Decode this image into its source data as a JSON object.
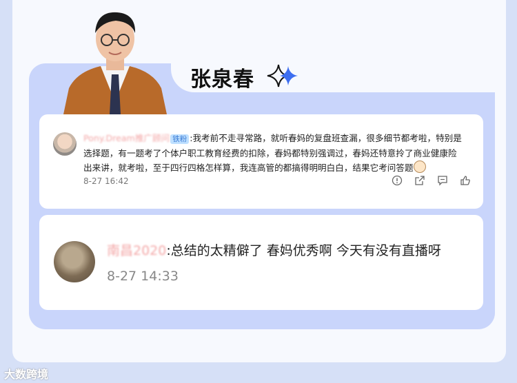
{
  "header": {
    "author_name": "张泉春"
  },
  "comments": [
    {
      "username": "Pony.Dream推广顾问",
      "badge": "铁粉",
      "text": ":我考前不走寻常路，就听春妈的复盘班查漏，很多细节都考啦，特别是选择题，有一题考了个体户职工教育经费的扣除，春妈都特别强调过，春妈还特意拎了商业健康险出来讲，就考啦，至于四行四格怎样算，我连高管的都搞得明明白白，结果它考问答题",
      "time": "8-27 16:42"
    },
    {
      "username": "南昌2020",
      "text": ":总结的太精僻了 春妈优秀啊 今天有没有直播呀",
      "time": "8-27 14:33"
    }
  ],
  "watermark": "大数跨境",
  "icons": [
    "report-icon",
    "share-icon",
    "comment-icon",
    "like-icon",
    "sparkle-icon"
  ]
}
